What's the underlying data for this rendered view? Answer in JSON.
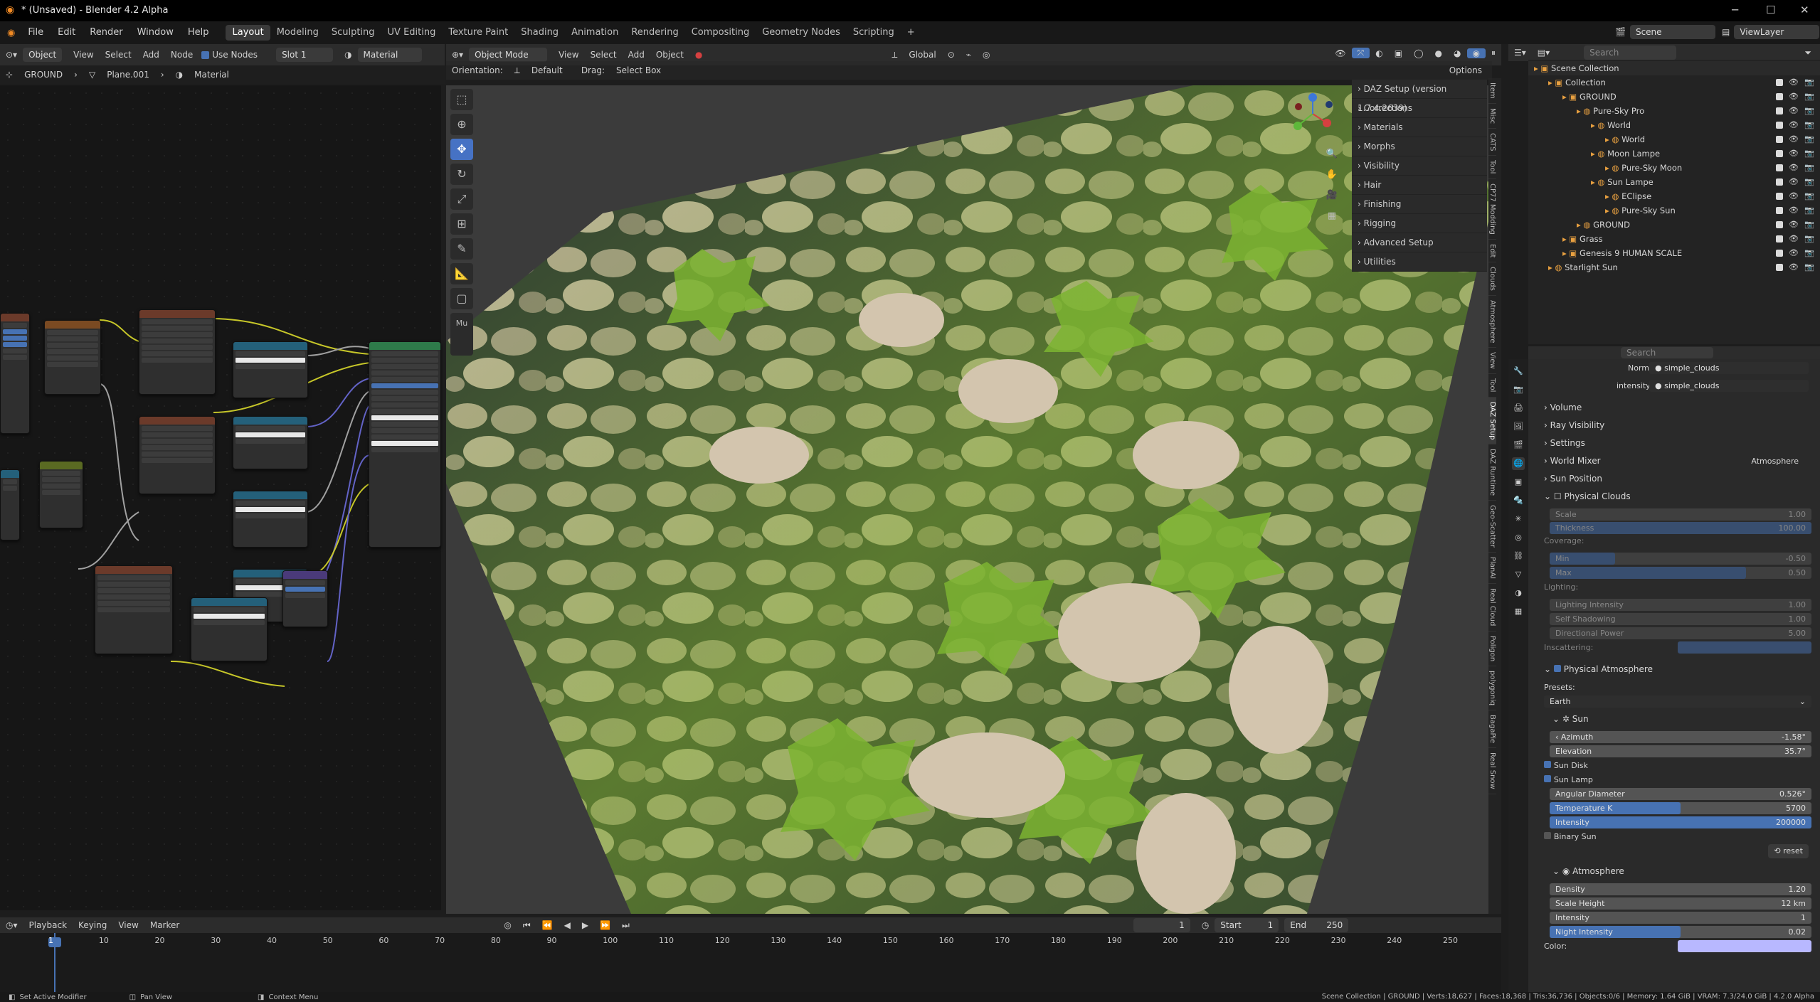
{
  "window": {
    "title": "* (Unsaved) - Blender 4.2 Alpha",
    "minimize": "─",
    "maximize": "☐",
    "close": "✕"
  },
  "menu": [
    "File",
    "Edit",
    "Render",
    "Window",
    "Help"
  ],
  "workspaces": [
    "Layout",
    "Modeling",
    "Sculpting",
    "UV Editing",
    "Texture Paint",
    "Shading",
    "Animation",
    "Rendering",
    "Compositing",
    "Geometry Nodes",
    "Scripting",
    "+"
  ],
  "scene": {
    "label": "Scene",
    "viewlayer": "ViewLayer",
    "search_placeholder": "Search"
  },
  "node_editor": {
    "header": {
      "object": "Object",
      "view": "View",
      "select": "Select",
      "add": "Add",
      "node": "Node",
      "use_nodes": "Use Nodes",
      "slot": "Slot 1",
      "material": "Material"
    },
    "breadcrumb": [
      "GROUND",
      "Plane.001",
      "Material"
    ]
  },
  "viewport": {
    "header": {
      "mode": "Object Mode",
      "view": "View",
      "select": "Select",
      "add": "Add",
      "object": "Object",
      "transform": "Global"
    },
    "subheader": {
      "orientation_label": "Orientation:",
      "orientation": "Default",
      "drag_label": "Drag:",
      "drag": "Select Box",
      "options": "Options"
    },
    "npanel": [
      "DAZ Setup (version 1.7.4.2639)",
      "Corrections",
      "Materials",
      "Morphs",
      "Visibility",
      "Hair",
      "Finishing",
      "Rigging",
      "Advanced Setup",
      "Utilities"
    ],
    "vtabs": [
      "Item",
      "Misc",
      "CATS",
      "Tool",
      "CP77 Modding",
      "Edit",
      "Clouds",
      "Atmosphere",
      "View",
      "Tool",
      "DAZ Setup",
      "DAZ Runtime",
      "Geo-Scatter",
      "PlanAI",
      "Real Cloud",
      "Poligon",
      "polygoniq",
      "BagaPie",
      "Real Snow"
    ],
    "collapsed_panel": "Mu"
  },
  "outliner": {
    "items": [
      {
        "label": "Scene Collection",
        "depth": 0
      },
      {
        "label": "Collection",
        "depth": 1
      },
      {
        "label": "GROUND",
        "depth": 2
      },
      {
        "label": "Pure-Sky Pro",
        "depth": 3
      },
      {
        "label": "World",
        "depth": 4
      },
      {
        "label": "World",
        "depth": 5
      },
      {
        "label": "Moon Lampe",
        "depth": 4
      },
      {
        "label": "Pure-Sky Moon",
        "depth": 5
      },
      {
        "label": "Sun Lampe",
        "depth": 4
      },
      {
        "label": "EClipse",
        "depth": 5
      },
      {
        "label": "Pure-Sky Sun",
        "depth": 5
      },
      {
        "label": "GROUND",
        "depth": 3
      },
      {
        "label": "Grass",
        "depth": 2
      },
      {
        "label": "Genesis 9 HUMAN SCALE",
        "depth": 2
      },
      {
        "label": "Starlight Sun",
        "depth": 1
      }
    ]
  },
  "properties": {
    "search_placeholder": "Search",
    "normal_label": "Normal",
    "normal_value": "simple_clouds",
    "intensity_label": "intensity",
    "intensity_value": "simple_clouds",
    "panels": [
      "Volume",
      "Ray Visibility",
      "Settings",
      "World Mixer",
      "Sun Position"
    ],
    "world_mixer_value": "Atmosphere",
    "physical_clouds": "Physical Clouds",
    "scale_label": "Scale",
    "scale_value": "1.00",
    "thickness_label": "Thickness",
    "thickness_value": "100.00",
    "coverage_label": "Coverage:",
    "min_label": "Min",
    "min_value": "-0.50",
    "max_label": "Max",
    "max_value": "0.50",
    "lighting_label": "Lighting:",
    "li_label": "Lighting Intensity",
    "li_value": "1.00",
    "ss_label": "Self Shadowing",
    "ss_value": "1.00",
    "dp_label": "Directional Power",
    "dp_value": "5.00",
    "inscattering_label": "Inscattering:",
    "physical_atmosphere": "Physical Atmosphere",
    "presets_label": "Presets:",
    "preset": "Earth",
    "sun_label": "Sun",
    "azimuth_label": "Azimuth",
    "azimuth_value": "-1.58°",
    "elevation_label": "Elevation",
    "elevation_value": "35.7°",
    "sun_disk": "Sun Disk",
    "sun_lamp": "Sun Lamp",
    "angular_label": "Angular Diameter",
    "angular_value": "0.526°",
    "temp_label": "Temperature K",
    "temp_value": "5700",
    "int_label": "Intensity",
    "int_value": "200000",
    "binary_sun": "Binary Sun",
    "reset": "reset",
    "atmosphere_label": "Atmosphere",
    "density_label": "Density",
    "density_value": "1.20",
    "scale_height_label": "Scale Height",
    "scale_height_value": "12 km",
    "a_int_label": "Intensity",
    "a_int_value": "1",
    "night_label": "Night Intensity",
    "night_value": "0.02",
    "color_label": "Color:"
  },
  "timeline": {
    "menu": [
      "Playback",
      "Keying",
      "View",
      "Marker"
    ],
    "current": "1",
    "start_label": "Start",
    "start": "1",
    "end_label": "End",
    "end": "250",
    "ticks": [
      "1",
      "10",
      "20",
      "30",
      "40",
      "50",
      "60",
      "70",
      "80",
      "90",
      "100",
      "110",
      "120",
      "130",
      "140",
      "150",
      "160",
      "170",
      "180",
      "190",
      "200",
      "210",
      "220",
      "230",
      "240",
      "250"
    ]
  },
  "status": {
    "left": [
      "Set Active Modifier",
      "Pan View",
      "Context Menu"
    ],
    "right": "Scene Collection | GROUND | Verts:18,627 | Faces:18,368 | Tris:36,736 | Objects:0/6 | Memory: 1.64 GiB | VRAM: 7.3/24.0 GiB | 4.2.0 Alpha"
  }
}
